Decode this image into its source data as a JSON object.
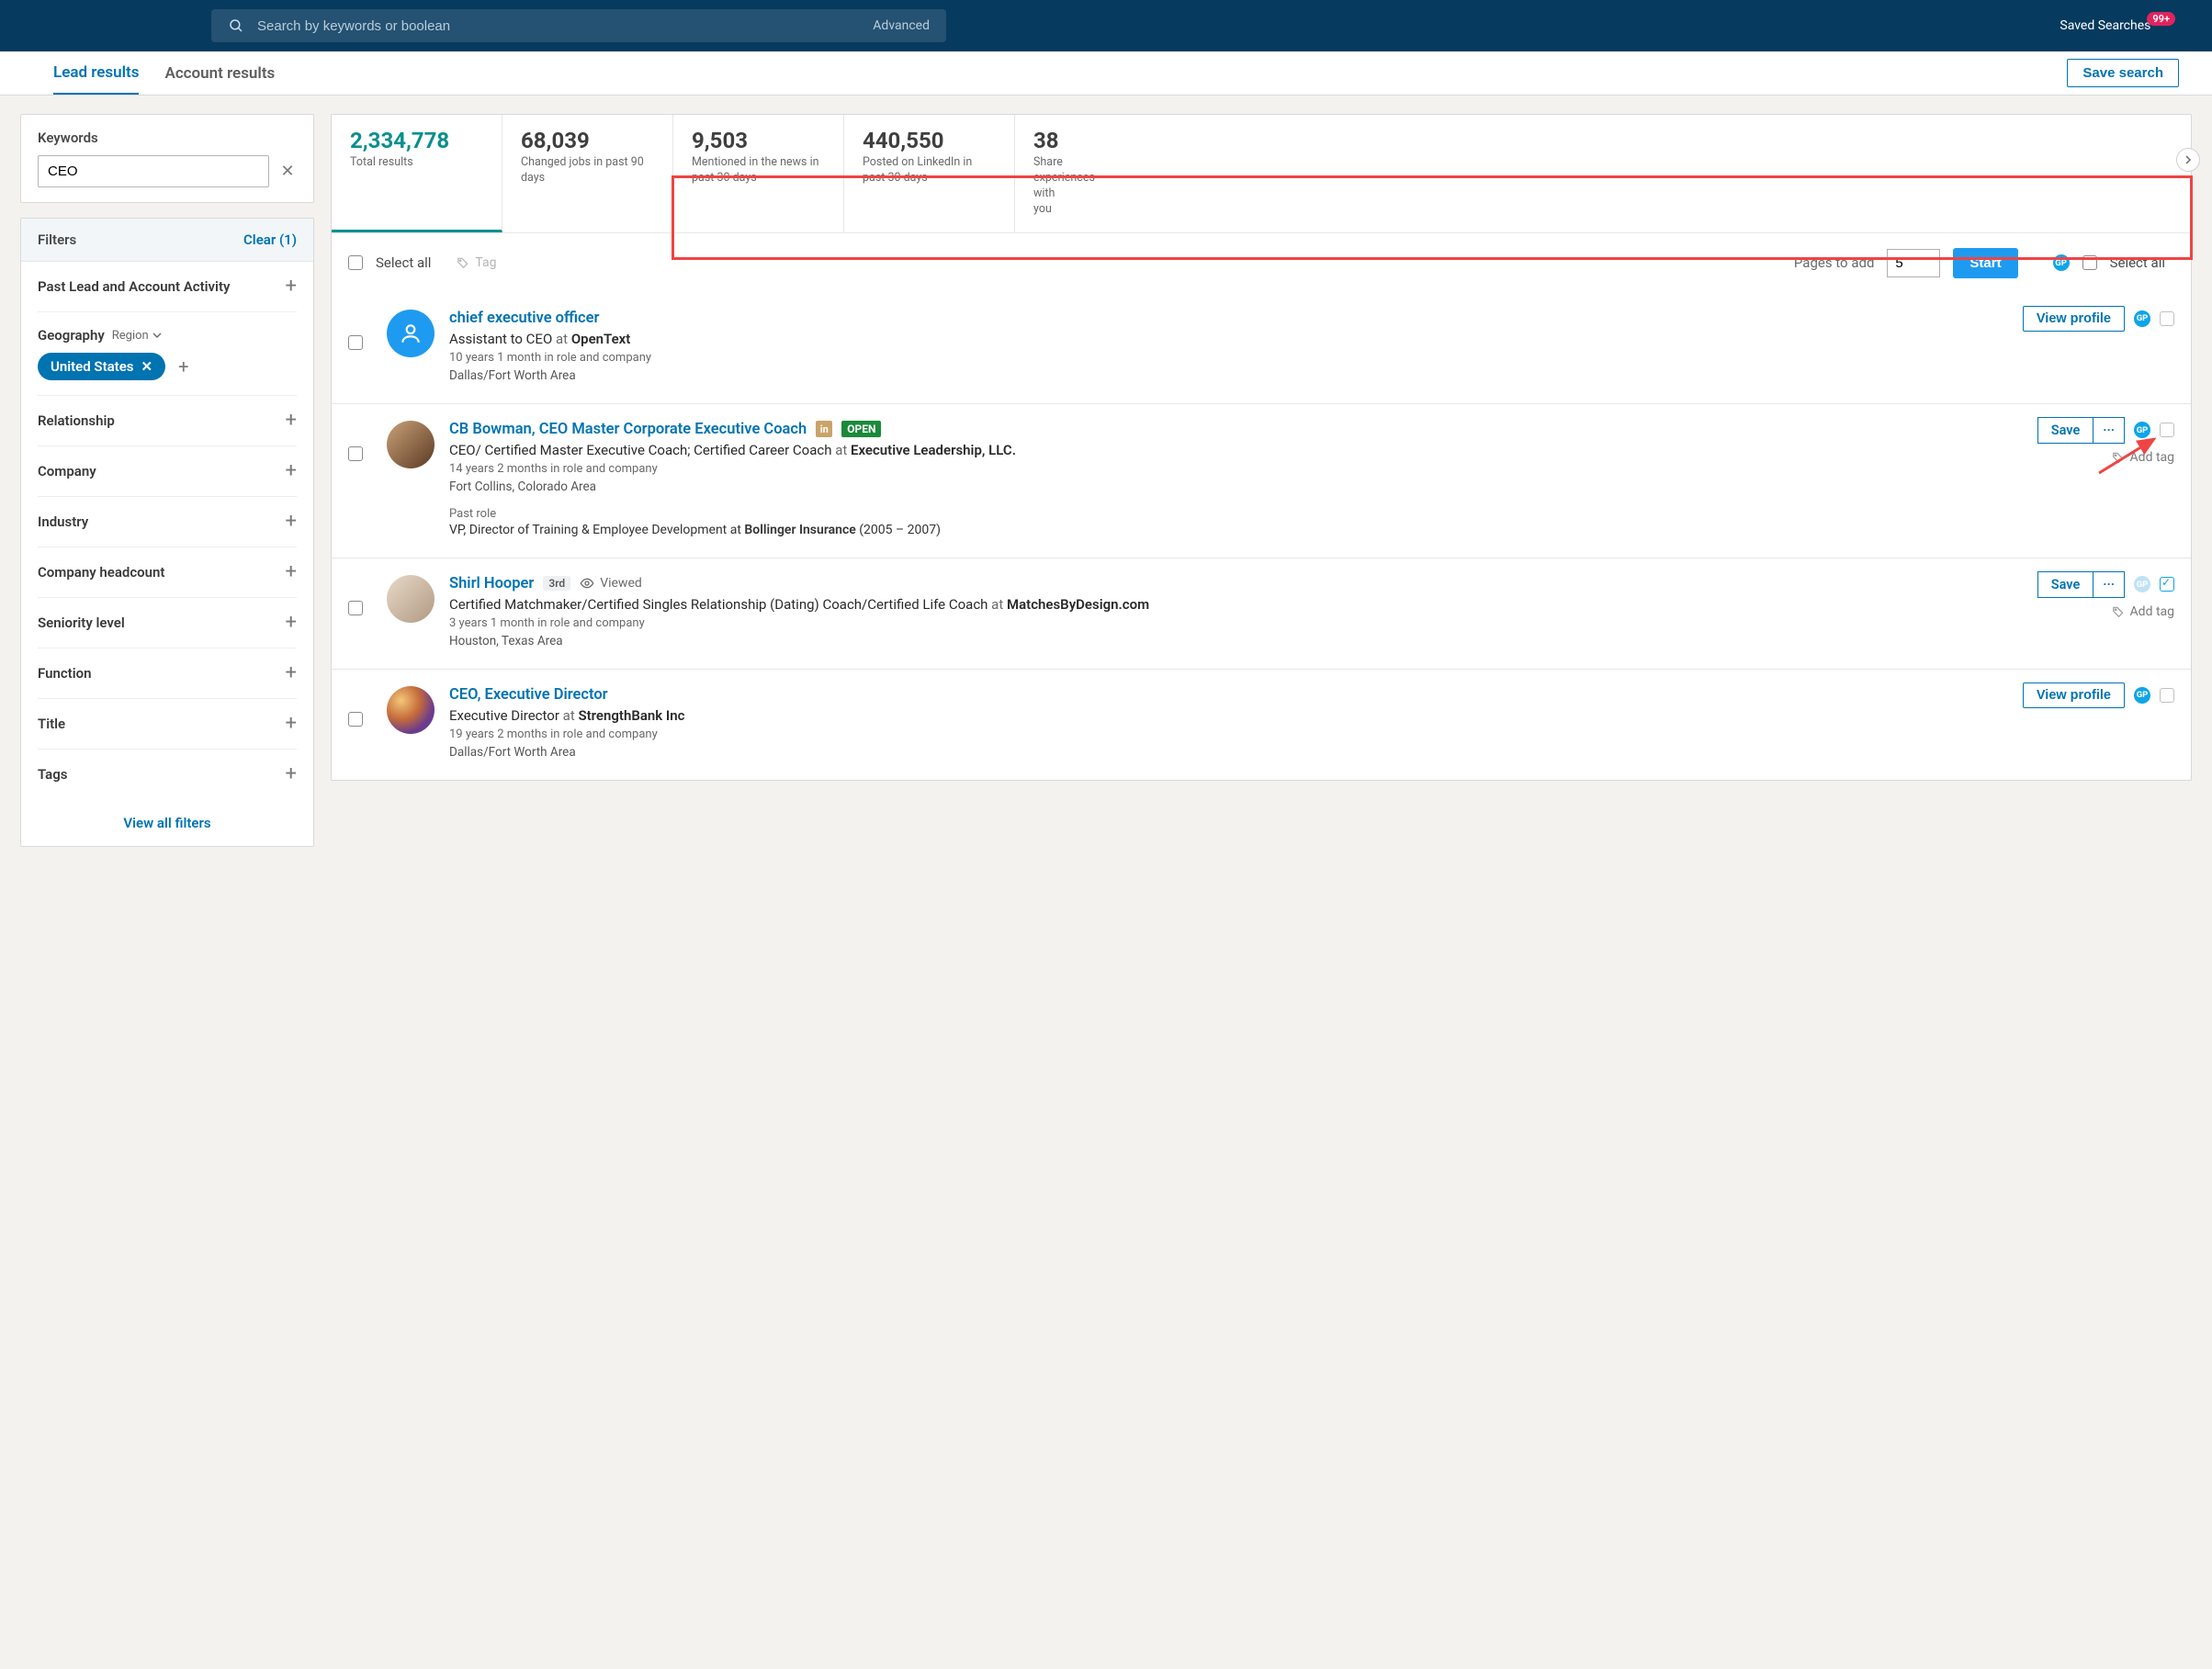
{
  "topbar": {
    "search_placeholder": "Search by keywords or boolean",
    "advanced": "Advanced",
    "saved_searches": "Saved Searches",
    "saved_badge": "99+"
  },
  "subnav": {
    "tab_lead": "Lead results",
    "tab_account": "Account results",
    "save_search": "Save search"
  },
  "sidebar": {
    "keywords_label": "Keywords",
    "keywords_value": "CEO",
    "filters_label": "Filters",
    "clear_label": "Clear (1)",
    "geo_label": "Geography",
    "geo_sub": "Region",
    "geo_chip": "United States",
    "facets": [
      "Past Lead and Account Activity",
      "Relationship",
      "Company",
      "Industry",
      "Company headcount",
      "Seniority level",
      "Function",
      "Title",
      "Tags"
    ],
    "view_all": "View all filters"
  },
  "stats": [
    {
      "num": "2,334,778",
      "lbl": "Total results"
    },
    {
      "num": "68,039",
      "lbl": "Changed jobs in past 90 days"
    },
    {
      "num": "9,503",
      "lbl": "Mentioned in the news in past 30 days"
    },
    {
      "num": "440,550",
      "lbl": "Posted on LinkedIn in past 30 days"
    },
    {
      "num": "38",
      "lbl": "Share experiences with you"
    }
  ],
  "ext": {
    "select_all": "Select all",
    "tag": "Tag",
    "pages_label": "Pages to add",
    "pages_value": "5",
    "start": "Start",
    "gp": "GP",
    "right_select_all": "Select all"
  },
  "actions": {
    "view_profile": "View profile",
    "save": "Save",
    "dots": "···",
    "add_tag": "Add tag",
    "viewed": "Viewed"
  },
  "common": {
    "at": "at",
    "past_role": "Past role"
  },
  "results": [
    {
      "name": "chief executive officer",
      "title": "Assistant to CEO",
      "company": "OpenText",
      "tenure": "10 years 1 month in role and company",
      "location": "Dallas/Fort Worth Area",
      "avatar": "default",
      "action": "view",
      "degree": "",
      "open": false,
      "in": false,
      "viewed": false,
      "past": null,
      "gp_dim": false,
      "checked": false
    },
    {
      "name": "CB Bowman, CEO Master Corporate Executive Coach",
      "title": "CEO/ Certified Master Executive Coach; Certified Career Coach",
      "company": "Executive Leadership, LLC.",
      "tenure": "14 years 2 months in role and company",
      "location": "Fort Collins, Colorado Area",
      "avatar": "photo1",
      "action": "save",
      "degree": "",
      "open": true,
      "in": true,
      "viewed": false,
      "past": {
        "role": "VP, Director of Training & Employee Development",
        "company": "Bollinger Insurance",
        "range": "(2005 – 2007)"
      },
      "gp_dim": false,
      "checked": false,
      "add_tag": true
    },
    {
      "name": "Shirl Hooper",
      "title": "Certified Matchmaker/Certified Singles Relationship (Dating) Coach/Certified Life Coach",
      "company": "MatchesByDesign.com",
      "tenure": "3 years 1 month in role and company",
      "location": "Houston, Texas Area",
      "avatar": "photo2",
      "action": "save",
      "degree": "3rd",
      "open": false,
      "in": false,
      "viewed": true,
      "past": null,
      "gp_dim": true,
      "checked": true,
      "add_tag": true
    },
    {
      "name": "CEO, Executive Director",
      "title": "Executive Director",
      "company": "StrengthBank Inc",
      "tenure": "19 years 2 months in role and company",
      "location": "Dallas/Fort Worth Area",
      "avatar": "photo3",
      "action": "view",
      "degree": "",
      "open": false,
      "in": false,
      "viewed": false,
      "past": null,
      "gp_dim": false,
      "checked": false
    }
  ]
}
